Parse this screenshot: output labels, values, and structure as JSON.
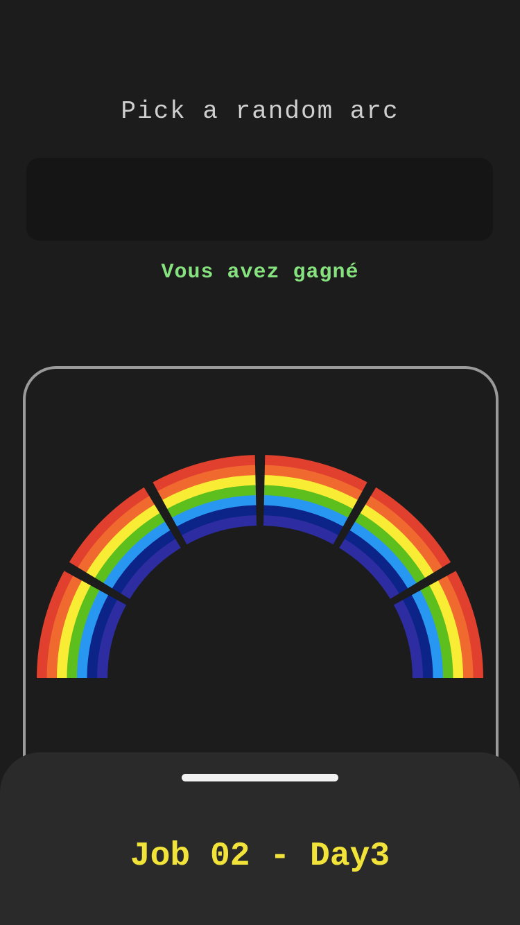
{
  "header": {
    "title": "Pick a random arc"
  },
  "result": {
    "value": ""
  },
  "status": {
    "text": "Vous avez gagné",
    "color": "#86e27e"
  },
  "rainbow": {
    "arc_count": 6,
    "band_colors": [
      "#e0402d",
      "#f0692e",
      "#f8ec34",
      "#5cbf1e",
      "#2897f2",
      "#0c2387",
      "#2d2ca0"
    ]
  },
  "footer": {
    "label": "Job 02 - Day3",
    "color": "#f2e33a"
  }
}
